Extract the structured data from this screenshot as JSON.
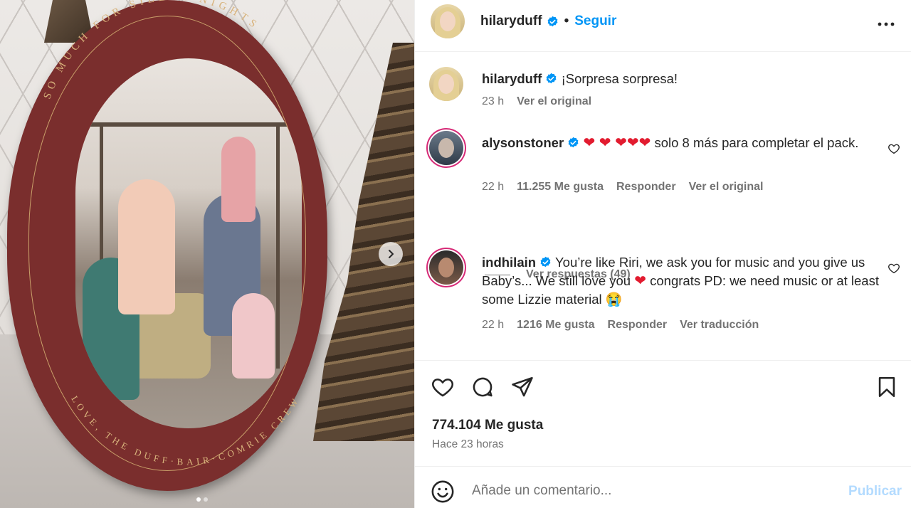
{
  "media": {
    "frame_top_text": "SO MUCH FOR SILENT NIGHTS",
    "frame_bottom_text": "LOVE, THE DUFF·BAIR·COMRIE CREW",
    "slide_index": 1,
    "slide_count": 2
  },
  "header": {
    "username": "hilaryduff",
    "separator": "•",
    "follow_label": "Seguir"
  },
  "caption": {
    "username": "hilaryduff",
    "text": "¡Sorpresa sorpresa!",
    "time": "23 h",
    "link": "Ver el original"
  },
  "comments": [
    {
      "username": "alysonstoner",
      "text": "solo 8 más para completar el pack.",
      "time": "22 h",
      "likes": "11.255 Me gusta",
      "reply": "Responder",
      "link": "Ver el original"
    },
    {
      "username": "indhilain",
      "text_part1": "You’re like Riri, we ask you for music and you give us Baby’s... We still love you",
      "text_part2": "congrats PD: we need music or at least some Lizzie material",
      "time": "22 h",
      "likes": "1216 Me gusta",
      "reply": "Responder",
      "link": "Ver traducción"
    }
  ],
  "replies_label": "Ver respuestas (49)",
  "actions": {
    "likes": "774.104 Me gusta",
    "time": "Hace 23 horas"
  },
  "composer": {
    "placeholder": "Añade un comentario...",
    "publish_label": "Publicar"
  },
  "colors": {
    "accent": "#0095f6",
    "verified": "#0095f6",
    "frame": "#7a2e2d"
  }
}
